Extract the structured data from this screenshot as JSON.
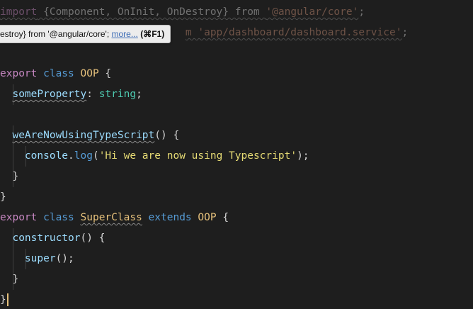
{
  "editor": {
    "lines": [
      {
        "tokens": [
          {
            "text": "import",
            "cls": "kw faded squig"
          },
          {
            "text": " {Component, OnInit, OnDestroy} from ",
            "cls": "punc faded squig"
          },
          {
            "text": "'@angular/core'",
            "cls": "str faded squig"
          },
          {
            "text": ";",
            "cls": "punc faded"
          }
        ]
      },
      {
        "tokens": [
          {
            "text": "                              ",
            "cls": "punc"
          },
          {
            "text": "m 'app/dashboard/dashboard.service'",
            "cls": "str faded squig"
          },
          {
            "text": ";",
            "cls": "punc faded"
          }
        ]
      },
      {
        "tokens": []
      },
      {
        "tokens": [
          {
            "text": "export",
            "cls": "kw"
          },
          {
            "text": " class ",
            "cls": "kw2"
          },
          {
            "text": "OOP",
            "cls": "cls"
          },
          {
            "text": " {",
            "cls": "punc"
          }
        ]
      },
      {
        "tokens": [
          {
            "text": "  ",
            "cls": "punc"
          },
          {
            "text": "someProperty",
            "cls": "fn squig"
          },
          {
            "text": ": ",
            "cls": "punc"
          },
          {
            "text": "string",
            "cls": "type"
          },
          {
            "text": ";",
            "cls": "punc"
          }
        ]
      },
      {
        "tokens": []
      },
      {
        "tokens": [
          {
            "text": "  ",
            "cls": "punc"
          },
          {
            "text": "weAreNowUsingTypeScript",
            "cls": "fn squig"
          },
          {
            "text": "() {",
            "cls": "punc"
          }
        ]
      },
      {
        "tokens": [
          {
            "text": "    ",
            "cls": "punc"
          },
          {
            "text": "console",
            "cls": "fn"
          },
          {
            "text": ".",
            "cls": "punc"
          },
          {
            "text": "log",
            "cls": "kw2"
          },
          {
            "text": "(",
            "cls": "punc"
          },
          {
            "text": "'Hi we are now using Typescript'",
            "cls": "str2"
          },
          {
            "text": ");",
            "cls": "punc"
          }
        ]
      },
      {
        "tokens": [
          {
            "text": "  }",
            "cls": "punc"
          }
        ]
      },
      {
        "tokens": [
          {
            "text": "}",
            "cls": "punc"
          }
        ]
      },
      {
        "tokens": [
          {
            "text": "export",
            "cls": "kw"
          },
          {
            "text": " class ",
            "cls": "kw2"
          },
          {
            "text": "SuperClass",
            "cls": "cls squig"
          },
          {
            "text": " extends ",
            "cls": "kw2"
          },
          {
            "text": "OOP",
            "cls": "cls"
          },
          {
            "text": " {",
            "cls": "punc"
          }
        ]
      },
      {
        "tokens": [
          {
            "text": "  ",
            "cls": "punc"
          },
          {
            "text": "constructor",
            "cls": "fn"
          },
          {
            "text": "() {",
            "cls": "punc"
          }
        ]
      },
      {
        "tokens": [
          {
            "text": "    ",
            "cls": "punc"
          },
          {
            "text": "super",
            "cls": "fn"
          },
          {
            "text": "();",
            "cls": "punc"
          }
        ]
      },
      {
        "tokens": [
          {
            "text": "  }",
            "cls": "punc"
          }
        ]
      },
      {
        "tokens": [
          {
            "text": "}",
            "cls": "punc"
          }
        ],
        "cursor": true
      }
    ]
  },
  "tooltip": {
    "text": "estroy} from '@angular/core';",
    "more_label": "more...",
    "shortcut": "(⌘F1)"
  }
}
